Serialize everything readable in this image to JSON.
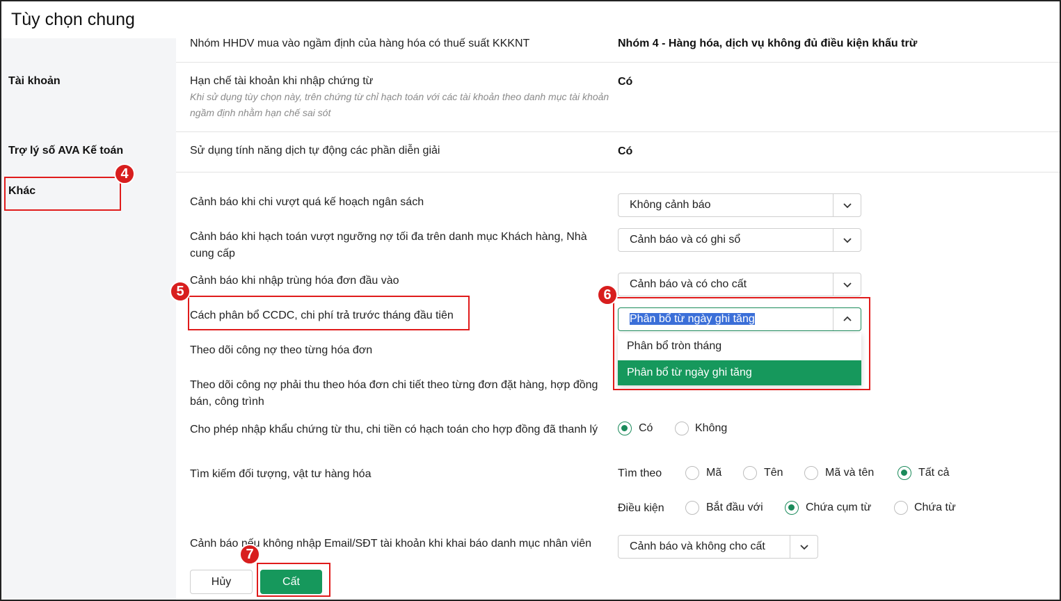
{
  "page": {
    "title": "Tùy chọn chung"
  },
  "sidebar": {
    "items": [
      {
        "label": "Tài khoản"
      },
      {
        "label": "Trợ lý số AVA Kế toán"
      },
      {
        "label": "Khác"
      }
    ]
  },
  "settings": {
    "nhom_hhdv": {
      "label": "Nhóm HHDV mua vào ngầm định của hàng hóa có thuế suất KKKNT",
      "value": "Nhóm 4 - Hàng hóa, dịch vụ không đủ điều kiện khấu trừ"
    },
    "han_che_tk": {
      "label": "Hạn chế tài khoản khi nhập chứng từ",
      "hint": "Khi sử dụng tùy chọn này, trên chứng từ chỉ hạch toán với các tài khoản theo danh mục tài khoản ngầm định nhằm hạn chế sai sót",
      "value": "Có"
    },
    "dich_tu_dong": {
      "label": "Sử dụng tính năng dịch tự động các phần diễn giải",
      "value": "Có"
    },
    "canh_bao_ngan_sach": {
      "label": "Cảnh báo khi chi vượt quá kế hoạch ngân sách",
      "value": "Không cảnh báo"
    },
    "canh_bao_no": {
      "label": "Cảnh báo khi hạch toán vượt ngưỡng nợ tối đa trên danh mục Khách hàng, Nhà cung cấp",
      "value": "Cảnh báo và có ghi sổ"
    },
    "canh_bao_trung_hd": {
      "label": "Cảnh báo khi nhập trùng hóa đơn đầu vào",
      "value": "Cảnh báo và có cho cất"
    },
    "phan_bo_ccdc": {
      "label": "Cách phân bổ CCDC, chi phí trả trước tháng đầu tiên",
      "value": "Phân bổ từ ngày ghi tăng",
      "options": [
        "Phân bổ tròn tháng",
        "Phân bổ từ ngày ghi tăng"
      ]
    },
    "theo_doi_cong_no": {
      "label": "Theo dõi công nợ theo từng hóa đơn"
    },
    "theo_doi_cong_no_phai_thu": {
      "label": "Theo dõi công nợ phải thu theo hóa đơn chi tiết theo từng đơn đặt hàng, hợp đồng bán, công trình"
    },
    "nhap_khau_ct": {
      "label": "Cho phép nhập khẩu chứng từ thu, chi tiền có hạch toán cho hợp đồng đã thanh lý",
      "opt_yes": "Có",
      "opt_no": "Không"
    },
    "tim_kiem": {
      "label": "Tìm kiếm đối tượng, vật tư hàng hóa",
      "tim_theo_label": "Tìm theo",
      "tim_theo_opts": [
        "Mã",
        "Tên",
        "Mã và tên",
        "Tất cả"
      ],
      "dieu_kien_label": "Điều kiện",
      "dieu_kien_opts": [
        "Bắt đầu với",
        "Chứa cụm từ",
        "Chứa từ"
      ]
    },
    "canh_bao_email": {
      "label": "Cảnh báo nếu không nhập Email/SĐT tài khoản khi khai báo danh mục nhân viên",
      "value": "Cảnh báo và không cho cất"
    }
  },
  "footer": {
    "cancel_label": "Hủy",
    "save_label": "Cất"
  },
  "annotations": {
    "b4": "4",
    "b5": "5",
    "b6": "6",
    "b7": "7"
  }
}
